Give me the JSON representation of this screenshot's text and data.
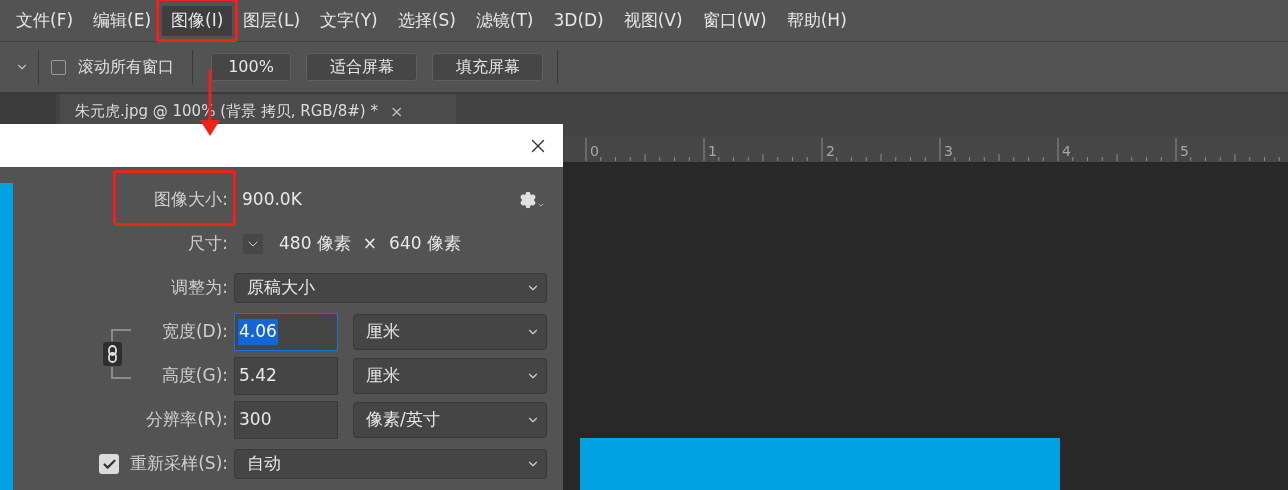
{
  "menu": [
    {
      "label": "文件(F)",
      "selected": false,
      "annotated": false
    },
    {
      "label": "编辑(E)",
      "selected": false,
      "annotated": false
    },
    {
      "label": "图像(I)",
      "selected": true,
      "annotated": true
    },
    {
      "label": "图层(L)",
      "selected": false,
      "annotated": false
    },
    {
      "label": "文字(Y)",
      "selected": false,
      "annotated": false
    },
    {
      "label": "选择(S)",
      "selected": false,
      "annotated": false
    },
    {
      "label": "滤镜(T)",
      "selected": false,
      "annotated": false
    },
    {
      "label": "3D(D)",
      "selected": false,
      "annotated": false
    },
    {
      "label": "视图(V)",
      "selected": false,
      "annotated": false
    },
    {
      "label": "窗口(W)",
      "selected": false,
      "annotated": false
    },
    {
      "label": "帮助(H)",
      "selected": false,
      "annotated": false
    }
  ],
  "options_bar": {
    "scroll_all": {
      "label": "滚动所有窗口",
      "checked": false
    },
    "buttons": [
      "100%",
      "适合屏幕",
      "填充屏幕"
    ]
  },
  "document_tab": {
    "title": "朱元虎.jpg @ 100% (背景 拷贝, RGB/8#) *",
    "close": "×"
  },
  "ruler": {
    "labels": [
      "0",
      "1",
      "2",
      "3",
      "4",
      "5"
    ]
  },
  "dialog": {
    "image_size": {
      "label": "图像大小:",
      "value": "900.0K",
      "annotated": true
    },
    "dimensions": {
      "label": "尺寸:",
      "width": "480 像素",
      "times": "×",
      "height": "640 像素"
    },
    "linked": true,
    "rows": [
      {
        "kind": "select",
        "label": "调整为:",
        "value": "原稿大小"
      },
      {
        "kind": "input_unit",
        "label": "宽度(D):",
        "value": "4.06",
        "selected": true,
        "unit": "厘米"
      },
      {
        "kind": "input_unit",
        "label": "高度(G):",
        "value": "5.42",
        "selected": false,
        "unit": "厘米"
      },
      {
        "kind": "input_unit",
        "label": "分辨率(R):",
        "value": "300",
        "selected": false,
        "unit": "像素/英寸"
      },
      {
        "kind": "checkbox_select",
        "label": "重新采样(S):",
        "checked": true,
        "value": "自动"
      }
    ]
  }
}
